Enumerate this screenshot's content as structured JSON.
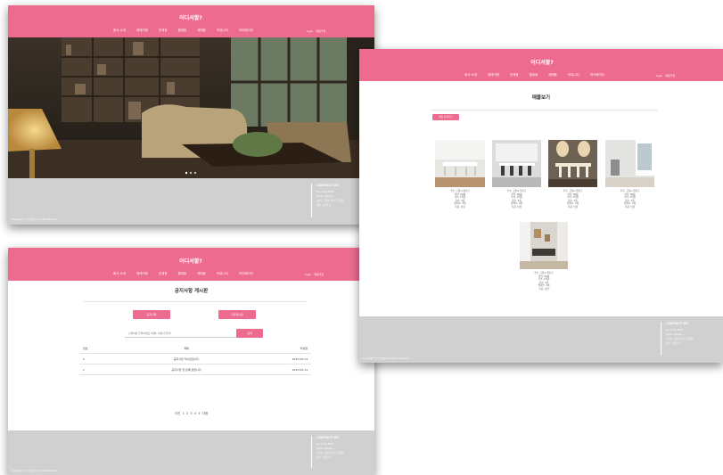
{
  "site": {
    "logo": "어디서팔?",
    "nav": [
      "회사 소개",
      "매매거래",
      "전세등",
      "월세등",
      "매매등",
      "커뮤니티",
      "마이페이지"
    ],
    "login": "login",
    "signup": "회원가입",
    "footer": {
      "contact_title": "CONTACT US",
      "lines": [
        "Tel. 1234-5678",
        "Email. Hello@...",
        "경기도 고양시 일산구 중앙로",
        "대표. 김부동산"
      ],
      "copyright": "Copyright ⓒ 어디서팔? All rights reserved."
    }
  },
  "board": {
    "title": "공지사항 게시판",
    "btn_left": "공지사항",
    "btn_right": "자유게시판",
    "search_placeholder": "검색어를 입력하세요 (제목, 작성자 입력)",
    "search_button": "검색",
    "columns": [
      "번호",
      "제목",
      "작성일"
    ],
    "rows": [
      {
        "no": "2",
        "title": "공지사항 게시판입니다",
        "date": "2023-09-14"
      },
      {
        "no": "1",
        "title": "공지사항 첫 번째 글입니다",
        "date": "2023-09-14"
      }
    ],
    "pagination": "이전  1  2  3  4  5  다음"
  },
  "listing": {
    "title": "매물보기",
    "register_button": "매물 등록하기",
    "item_meta": [
      "주소. 고양시 일산구",
      "면적. 00평",
      "가격. 1억원",
      "층수. 3층",
      "방개수. 3개",
      "특징. 남향"
    ]
  },
  "colors": {
    "brand": "#ee6b90",
    "footer": "#d0d0d0"
  }
}
